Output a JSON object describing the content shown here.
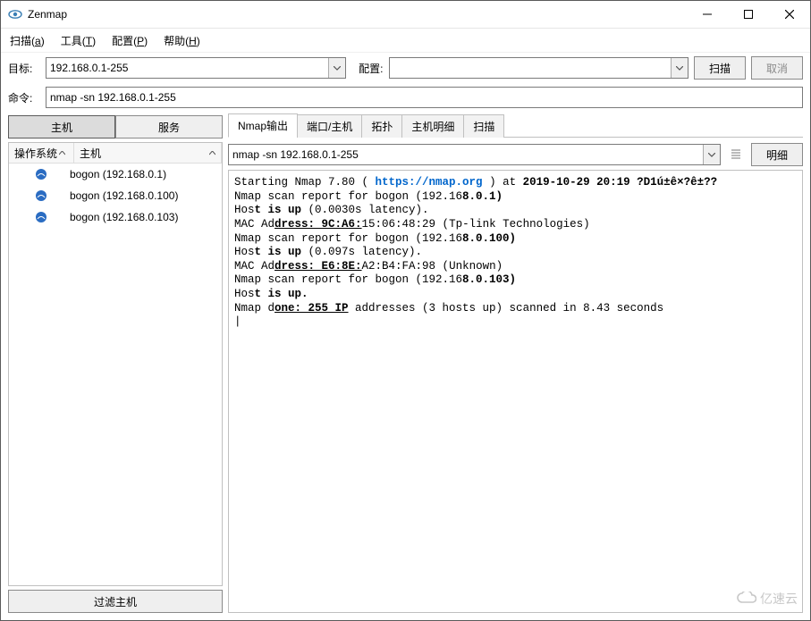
{
  "window": {
    "title": "Zenmap"
  },
  "menubar": [
    {
      "label": "扫描",
      "key": "a"
    },
    {
      "label": "工具",
      "key": "T"
    },
    {
      "label": "配置",
      "key": "P"
    },
    {
      "label": "帮助",
      "key": "H"
    }
  ],
  "inputs": {
    "target_label": "目标:",
    "target_value": "192.168.0.1-255",
    "profile_label": "配置:",
    "profile_value": "",
    "command_label": "命令:",
    "command_value": "nmap -sn 192.168.0.1-255",
    "scan_btn": "扫描",
    "cancel_btn": "取消"
  },
  "left": {
    "hosts_tab": "主机",
    "services_tab": "服务",
    "col_os": "操作系统",
    "col_host": "主机",
    "filter_btn": "过滤主机",
    "hosts": [
      {
        "name": "bogon (192.168.0.1)"
      },
      {
        "name": "bogon (192.168.0.100)"
      },
      {
        "name": "bogon (192.168.0.103)"
      }
    ]
  },
  "tabs": {
    "nmap_output": "Nmap输出",
    "ports_hosts": "端口/主机",
    "topology": "拓扑",
    "host_details": "主机明细",
    "scans": "扫描"
  },
  "output": {
    "dropdown_value": "nmap -sn 192.168.0.1-255",
    "detail_btn": "明细",
    "lines": {
      "l1a": "Starting Nmap 7.80 ( ",
      "l1b": "https://nmap.org",
      "l1c": " ) at ",
      "l1d": "2019-10-29 20:19 ?D1ú±ê×?ê±??",
      "l2a": "Nmap scan report for bogon (192.16",
      "l2b": "8.0.1)",
      "l3a": "Hos",
      "l3b": "t is up",
      "l3c": " (0.0030s latency).",
      "l4a": "MAC Ad",
      "l4b": "dress: 9C:A6:",
      "l4c": "15:06:48:29 (Tp-link Technologies)",
      "l5a": "Nmap scan report for bogon (192.16",
      "l5b": "8.0.100)",
      "l6a": "Hos",
      "l6b": "t is up",
      "l6c": " (0.097s latency).",
      "l7a": "MAC Ad",
      "l7b": "dress: E6:8E:",
      "l7c": "A2:B4:FA:98 (Unknown)",
      "l8a": "Nmap scan report for bogon (192.16",
      "l8b": "8.0.103)",
      "l9a": "Hos",
      "l9b": "t is up.",
      "l10a": "Nmap d",
      "l10b": "one: 255 IP",
      "l10c": " addresses (3 hosts up) scanned in 8.43 seconds"
    }
  },
  "watermark": "亿速云"
}
